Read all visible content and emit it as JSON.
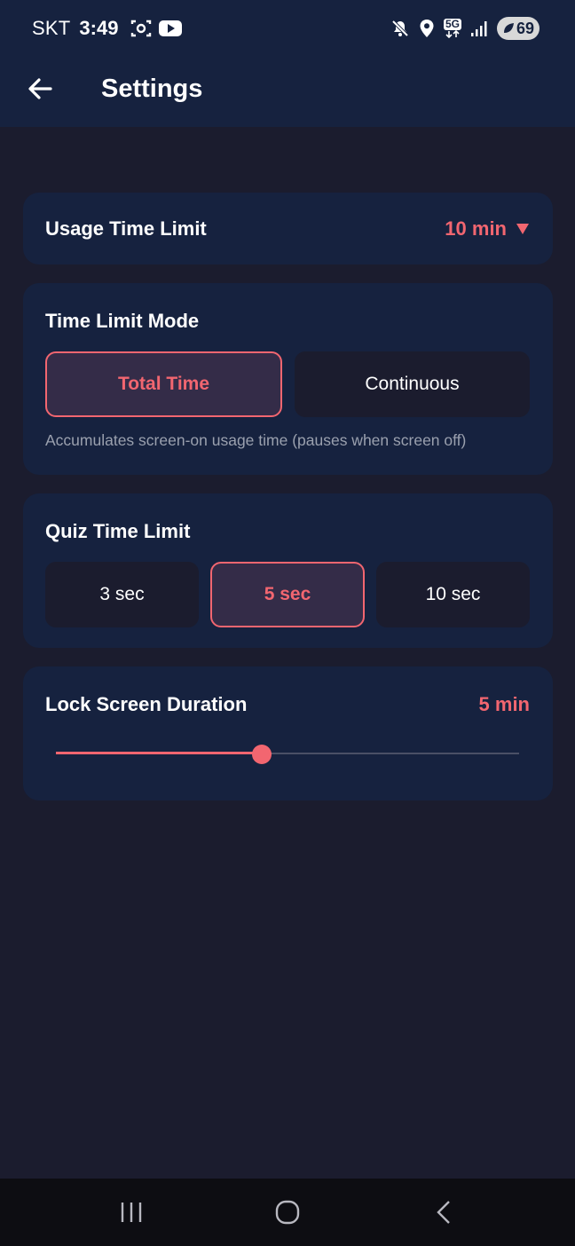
{
  "status_bar": {
    "carrier": "SKT",
    "time": "3:49",
    "battery": "69",
    "network": "5G",
    "icons": [
      "screenshot-icon",
      "youtube-icon",
      "mute-icon",
      "location-icon",
      "5g-icon",
      "signal-icon",
      "battery-icon"
    ]
  },
  "header": {
    "title": "Settings",
    "back_icon": "arrow-left-icon"
  },
  "usage_time_limit": {
    "label": "Usage Time Limit",
    "value": "10 min",
    "dropdown_icon": "triangle-down-icon"
  },
  "time_limit_mode": {
    "label": "Time Limit Mode",
    "options": [
      "Total Time",
      "Continuous"
    ],
    "selected": "Total Time",
    "description": "Accumulates screen-on usage time (pauses when screen off)"
  },
  "quiz_time_limit": {
    "label": "Quiz Time Limit",
    "options": [
      "3 sec",
      "5 sec",
      "10 sec"
    ],
    "selected": "5 sec"
  },
  "lock_screen_duration": {
    "label": "Lock Screen Duration",
    "value": "5 min",
    "slider_fraction": 0.444
  },
  "nav_bar": {
    "icons": [
      "recent-apps-icon",
      "home-icon",
      "back-icon"
    ]
  },
  "colors": {
    "accent": "#f26670",
    "background": "#1b1c2e",
    "surface": "#16223f",
    "selected_bg": "#342c48",
    "muted_text": "#9aa0ae"
  }
}
